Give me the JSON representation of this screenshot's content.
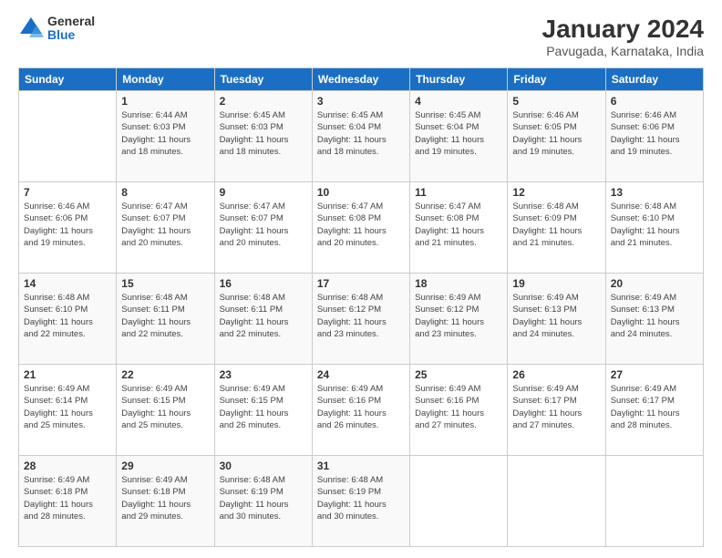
{
  "logo": {
    "general": "General",
    "blue": "Blue"
  },
  "header": {
    "title": "January 2024",
    "subtitle": "Pavugada, Karnataka, India"
  },
  "calendar": {
    "days_of_week": [
      "Sunday",
      "Monday",
      "Tuesday",
      "Wednesday",
      "Thursday",
      "Friday",
      "Saturday"
    ],
    "weeks": [
      [
        {
          "day": "",
          "info": ""
        },
        {
          "day": "1",
          "info": "Sunrise: 6:44 AM\nSunset: 6:03 PM\nDaylight: 11 hours\nand 18 minutes."
        },
        {
          "day": "2",
          "info": "Sunrise: 6:45 AM\nSunset: 6:03 PM\nDaylight: 11 hours\nand 18 minutes."
        },
        {
          "day": "3",
          "info": "Sunrise: 6:45 AM\nSunset: 6:04 PM\nDaylight: 11 hours\nand 18 minutes."
        },
        {
          "day": "4",
          "info": "Sunrise: 6:45 AM\nSunset: 6:04 PM\nDaylight: 11 hours\nand 19 minutes."
        },
        {
          "day": "5",
          "info": "Sunrise: 6:46 AM\nSunset: 6:05 PM\nDaylight: 11 hours\nand 19 minutes."
        },
        {
          "day": "6",
          "info": "Sunrise: 6:46 AM\nSunset: 6:06 PM\nDaylight: 11 hours\nand 19 minutes."
        }
      ],
      [
        {
          "day": "7",
          "info": "Sunrise: 6:46 AM\nSunset: 6:06 PM\nDaylight: 11 hours\nand 19 minutes."
        },
        {
          "day": "8",
          "info": "Sunrise: 6:47 AM\nSunset: 6:07 PM\nDaylight: 11 hours\nand 20 minutes."
        },
        {
          "day": "9",
          "info": "Sunrise: 6:47 AM\nSunset: 6:07 PM\nDaylight: 11 hours\nand 20 minutes."
        },
        {
          "day": "10",
          "info": "Sunrise: 6:47 AM\nSunset: 6:08 PM\nDaylight: 11 hours\nand 20 minutes."
        },
        {
          "day": "11",
          "info": "Sunrise: 6:47 AM\nSunset: 6:08 PM\nDaylight: 11 hours\nand 21 minutes."
        },
        {
          "day": "12",
          "info": "Sunrise: 6:48 AM\nSunset: 6:09 PM\nDaylight: 11 hours\nand 21 minutes."
        },
        {
          "day": "13",
          "info": "Sunrise: 6:48 AM\nSunset: 6:10 PM\nDaylight: 11 hours\nand 21 minutes."
        }
      ],
      [
        {
          "day": "14",
          "info": "Sunrise: 6:48 AM\nSunset: 6:10 PM\nDaylight: 11 hours\nand 22 minutes."
        },
        {
          "day": "15",
          "info": "Sunrise: 6:48 AM\nSunset: 6:11 PM\nDaylight: 11 hours\nand 22 minutes."
        },
        {
          "day": "16",
          "info": "Sunrise: 6:48 AM\nSunset: 6:11 PM\nDaylight: 11 hours\nand 22 minutes."
        },
        {
          "day": "17",
          "info": "Sunrise: 6:48 AM\nSunset: 6:12 PM\nDaylight: 11 hours\nand 23 minutes."
        },
        {
          "day": "18",
          "info": "Sunrise: 6:49 AM\nSunset: 6:12 PM\nDaylight: 11 hours\nand 23 minutes."
        },
        {
          "day": "19",
          "info": "Sunrise: 6:49 AM\nSunset: 6:13 PM\nDaylight: 11 hours\nand 24 minutes."
        },
        {
          "day": "20",
          "info": "Sunrise: 6:49 AM\nSunset: 6:13 PM\nDaylight: 11 hours\nand 24 minutes."
        }
      ],
      [
        {
          "day": "21",
          "info": "Sunrise: 6:49 AM\nSunset: 6:14 PM\nDaylight: 11 hours\nand 25 minutes."
        },
        {
          "day": "22",
          "info": "Sunrise: 6:49 AM\nSunset: 6:15 PM\nDaylight: 11 hours\nand 25 minutes."
        },
        {
          "day": "23",
          "info": "Sunrise: 6:49 AM\nSunset: 6:15 PM\nDaylight: 11 hours\nand 26 minutes."
        },
        {
          "day": "24",
          "info": "Sunrise: 6:49 AM\nSunset: 6:16 PM\nDaylight: 11 hours\nand 26 minutes."
        },
        {
          "day": "25",
          "info": "Sunrise: 6:49 AM\nSunset: 6:16 PM\nDaylight: 11 hours\nand 27 minutes."
        },
        {
          "day": "26",
          "info": "Sunrise: 6:49 AM\nSunset: 6:17 PM\nDaylight: 11 hours\nand 27 minutes."
        },
        {
          "day": "27",
          "info": "Sunrise: 6:49 AM\nSunset: 6:17 PM\nDaylight: 11 hours\nand 28 minutes."
        }
      ],
      [
        {
          "day": "28",
          "info": "Sunrise: 6:49 AM\nSunset: 6:18 PM\nDaylight: 11 hours\nand 28 minutes."
        },
        {
          "day": "29",
          "info": "Sunrise: 6:49 AM\nSunset: 6:18 PM\nDaylight: 11 hours\nand 29 minutes."
        },
        {
          "day": "30",
          "info": "Sunrise: 6:48 AM\nSunset: 6:19 PM\nDaylight: 11 hours\nand 30 minutes."
        },
        {
          "day": "31",
          "info": "Sunrise: 6:48 AM\nSunset: 6:19 PM\nDaylight: 11 hours\nand 30 minutes."
        },
        {
          "day": "",
          "info": ""
        },
        {
          "day": "",
          "info": ""
        },
        {
          "day": "",
          "info": ""
        }
      ]
    ]
  }
}
